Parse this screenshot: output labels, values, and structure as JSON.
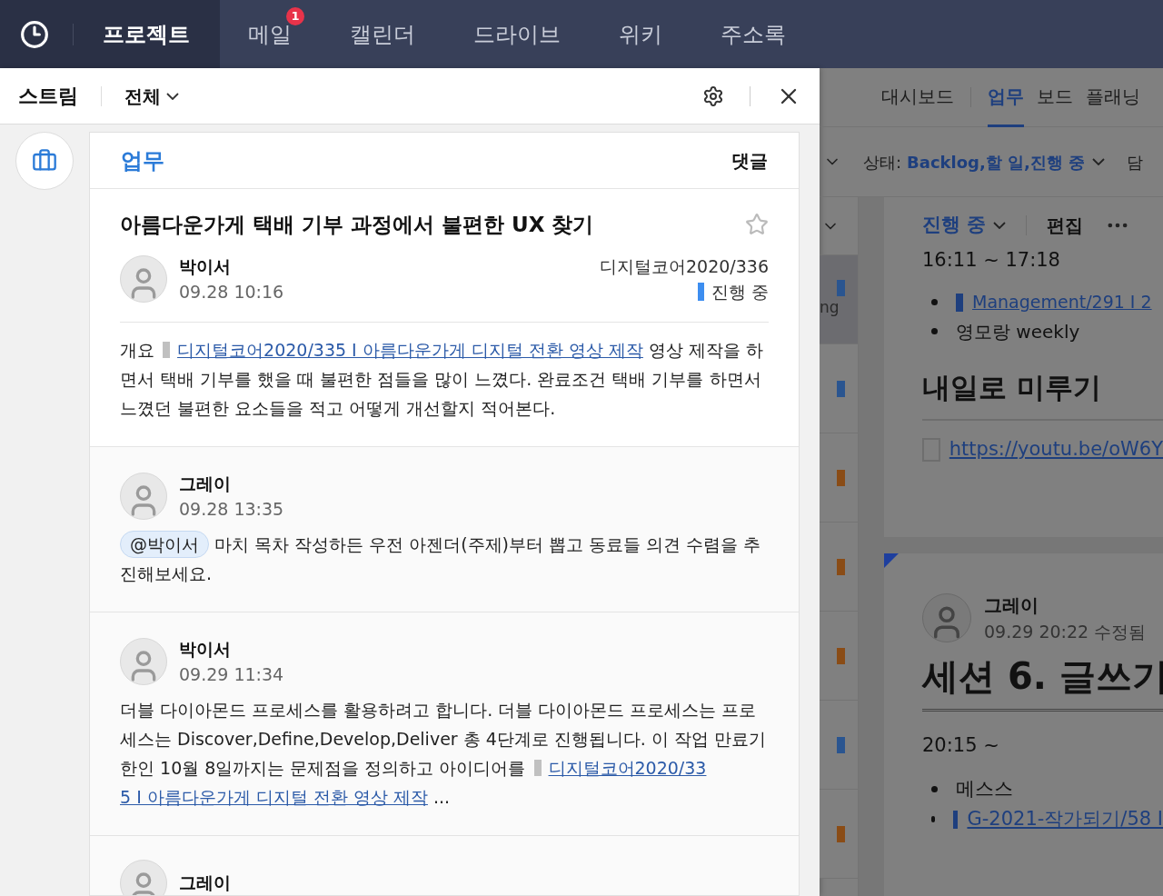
{
  "nav": {
    "tabs": [
      {
        "label": "프로젝트",
        "selected": true
      },
      {
        "label": "메일",
        "selected": false,
        "badge": "1"
      },
      {
        "label": "캘린더",
        "selected": false
      },
      {
        "label": "드라이브",
        "selected": false
      },
      {
        "label": "위키",
        "selected": false
      },
      {
        "label": "주소록",
        "selected": false
      }
    ]
  },
  "stream": {
    "title": "스트림",
    "filter": "전체"
  },
  "post": {
    "category": "업무",
    "comment_label": "댓글",
    "title": "아름다운가게 택배 기부 과정에서 불편한 UX 찾기",
    "starred": false,
    "author": "박이서",
    "time": "09.28  10:16",
    "project": "디지털코어2020/336",
    "status": "진행 중",
    "body": [
      {
        "kind": "text",
        "text": "개요 "
      },
      {
        "kind": "marker"
      },
      {
        "kind": "link",
        "text": "디지털코어2020/335 I 아름다운가게 디지털 전환 영상 제작"
      },
      {
        "kind": "text",
        "text": " 영상 제작을 하면서 택배 기부를 했을 때 불편한 점들을 많이 느꼈다. 완료조건 택배 기부를 하면서 느꼈던 불편한 요소들을 적고 어떻게 개선할지 적어본다."
      }
    ]
  },
  "comments": [
    {
      "author": "그레이",
      "time": "09.28  13:35",
      "parts": [
        {
          "kind": "mention",
          "text": "@박이서"
        },
        {
          "kind": "text",
          "text": " 마치 목차 작성하든 우전 아젠더(주제)부터 뽑고 동료들 의견 수렴을 추진해보세요."
        }
      ]
    },
    {
      "author": "박이서",
      "time": "09.29  11:34",
      "parts": [
        {
          "kind": "text",
          "text": "더블 다이아몬드 프로세스를 활용하려고 합니다. 더블 다이아몬드 프로세스는 프로세스는 Discover,Define,Develop,Deliver 총 4단계로 진행됩니다. 이 작업 만료기한인 10월 8일까지는 문제점을 정의하고 아이디어를 "
        },
        {
          "kind": "marker"
        },
        {
          "kind": "link",
          "text": "디지털코어2020/33"
        },
        {
          "kind": "link",
          "text": "5 I 아름다운가게 디지털 전환 영상 제작"
        },
        {
          "kind": "text",
          "text": " ..."
        }
      ]
    },
    {
      "author": "그레이"
    }
  ],
  "background_app": {
    "tabs": [
      {
        "label": "대시보드",
        "selected": false
      },
      {
        "label": "업무",
        "selected": true
      },
      {
        "label": "보드",
        "selected": false
      },
      {
        "label": "플래닝",
        "selected": false
      }
    ],
    "filter": {
      "label": "상태:",
      "value": "Backlog,할 일,진행 중",
      "next": "담"
    },
    "rows": [
      {
        "color": "#2a5590",
        "text": "ng",
        "selected": true
      },
      {
        "color": "#2a5590",
        "selected": false
      },
      {
        "color": "#8a4c16",
        "selected": false
      },
      {
        "color": "#8a4c16",
        "selected": false
      },
      {
        "color": "#8a4c16",
        "selected": false
      },
      {
        "color": "#2a5590",
        "selected": false
      },
      {
        "color": "#8a4c16",
        "selected": false
      }
    ],
    "card1": {
      "status": "진행 중",
      "edit": "편집",
      "time": "16:11 ~ 17:18",
      "bullets": [
        {
          "kind": "link",
          "text": "Management/291 I 2"
        },
        {
          "kind": "text",
          "text": "영모랑 weekly"
        }
      ],
      "heading": "내일로 미루기",
      "todo": {
        "checked": false,
        "text": "https://youtu.be/oW6Y"
      }
    },
    "card2": {
      "author": "그레이",
      "time": "09.29 20:22 수정됨",
      "heading": "세션 6. 글쓰기",
      "time_range": "20:15 ~",
      "bullets": [
        {
          "kind": "text",
          "text": "메스스"
        },
        {
          "kind": "link",
          "text": "G-2021-작가되기/58 I"
        }
      ]
    }
  }
}
